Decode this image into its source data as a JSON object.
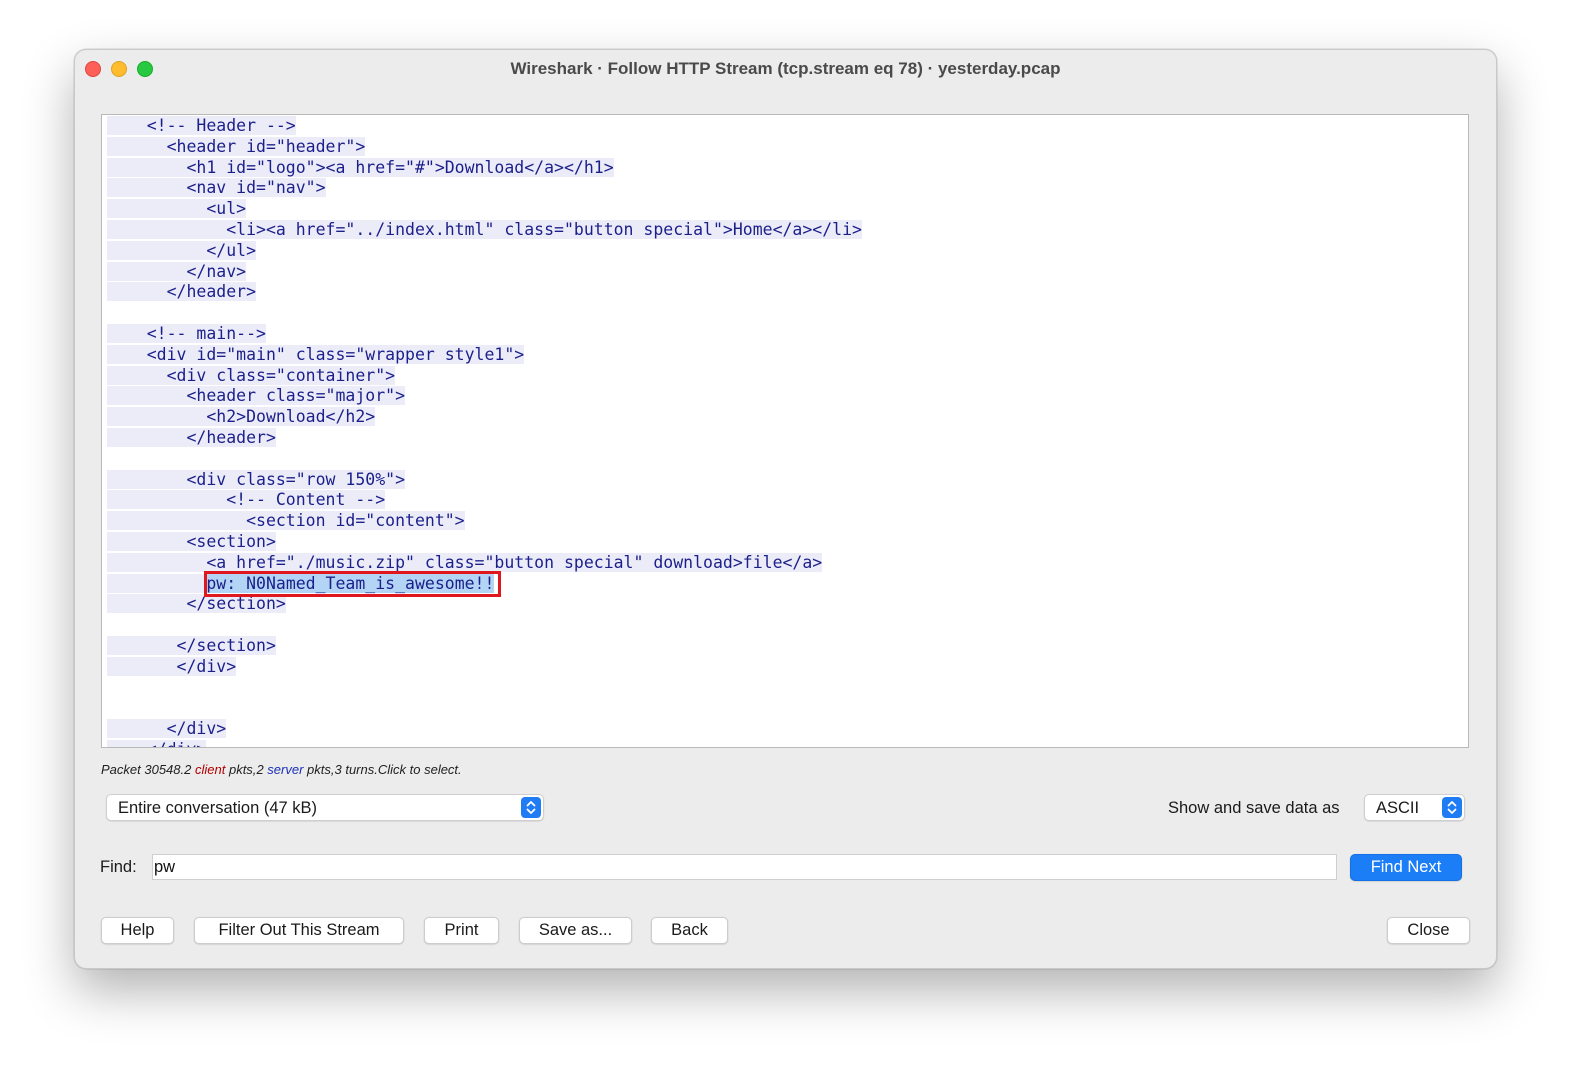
{
  "window": {
    "title": "Wireshark · Follow HTTP Stream (tcp.stream eq 78) · yesterday.pcap"
  },
  "stream": {
    "lines": [
      "    <!-- Header -->",
      "      <header id=\"header\">",
      "        <h1 id=\"logo\"><a href=\"#\">Download</a></h1>",
      "        <nav id=\"nav\">",
      "          <ul>",
      "            <li><a href=\"../index.html\" class=\"button special\">Home</a></li>",
      "          </ul>",
      "        </nav>",
      "      </header>",
      "",
      "    <!-- main-->",
      "    <div id=\"main\" class=\"wrapper style1\">",
      "      <div class=\"container\">",
      "        <header class=\"major\">",
      "          <h2>Download</h2>",
      "        </header>",
      "",
      "        <div class=\"row 150%\">",
      "            <!-- Content -->",
      "              <section id=\"content\">",
      "        <section>",
      "          <a href=\"./music.zip\" class=\"button special\" download>file</a>",
      "          pw: N0Named_Team_is_awesome!!",
      "        </section>",
      "",
      "       </section>",
      "       </div>",
      "",
      "",
      "      </div>",
      "    </div>"
    ],
    "highlighted_line_index": 22
  },
  "status": {
    "prefix": "Packet 30548.",
    "client_count": "2",
    "client_word": "client",
    "mid": "pkts,",
    "server_count": "2",
    "server_word": "server",
    "suffix": "pkts,3 turns.Click to select."
  },
  "conversation_select": {
    "value": "Entire conversation (47 kB)"
  },
  "show_save": {
    "label": "Show and save data as",
    "value": "ASCII"
  },
  "find": {
    "label": "Find:",
    "value": "pw",
    "button": "Find Next"
  },
  "buttons": {
    "help": "Help",
    "filter_out": "Filter Out This Stream",
    "print": "Print",
    "save_as": "Save as...",
    "back": "Back",
    "close": "Close"
  },
  "colors": {
    "code_text": "#1b1f8a",
    "code_bg": "#ececf9",
    "highlight_border": "#e1171e",
    "primary_button": "#1c7ef7"
  }
}
